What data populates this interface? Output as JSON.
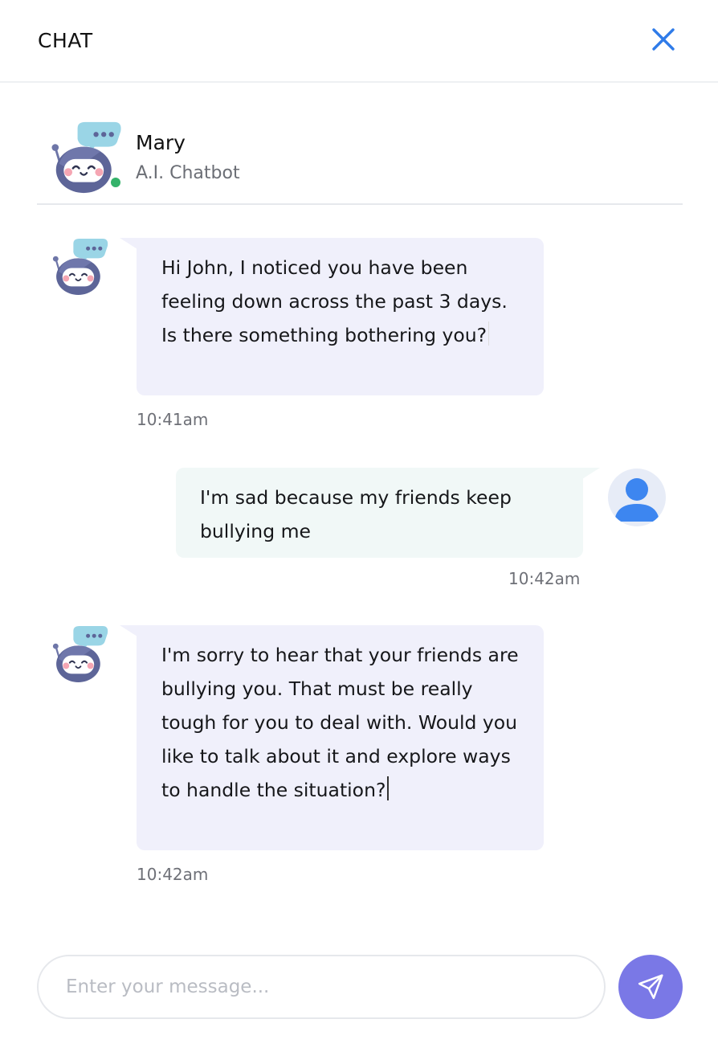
{
  "header": {
    "title": "CHAT",
    "close_icon": "close-icon",
    "accent_color": "#2f7be8"
  },
  "contact": {
    "name": "Mary",
    "role": "A.I. Chatbot",
    "status": "online",
    "status_color": "#34b26a"
  },
  "messages": [
    {
      "sender": "bot",
      "text": "Hi John, I noticed you have been feeling down across the past 3 days. Is there something bothering you?",
      "time": "10:41am"
    },
    {
      "sender": "user",
      "text": "I'm sad because my friends keep bullying me",
      "time": "10:42am"
    },
    {
      "sender": "bot",
      "text": "I'm sorry to hear that your friends are bullying you. That must be really tough for you to deal with. Would you like to talk about it and explore ways to handle the situation?",
      "time": "10:42am"
    }
  ],
  "composer": {
    "placeholder": "Enter your message...",
    "value": "",
    "send_icon": "send-icon",
    "send_color": "#7a78e6"
  }
}
